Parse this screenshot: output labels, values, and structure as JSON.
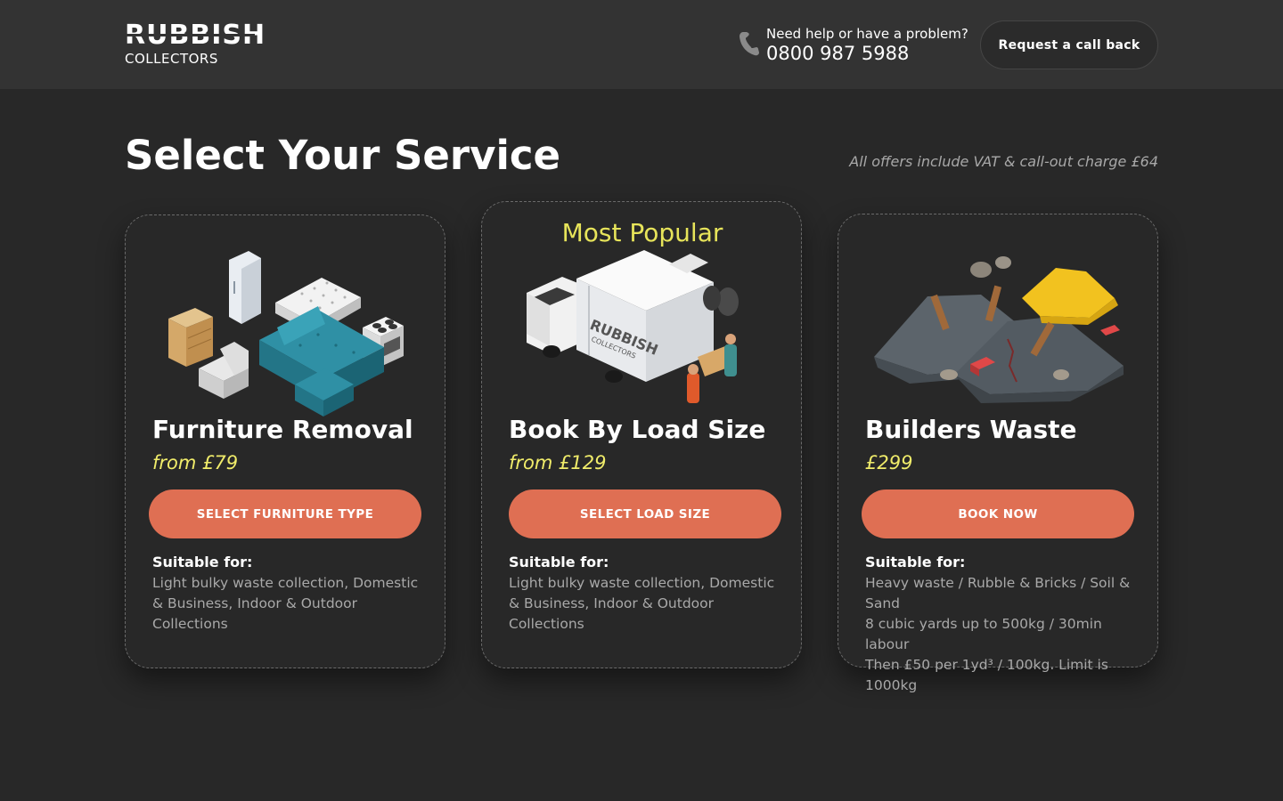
{
  "header": {
    "logo_top": "RUBBISH",
    "logo_bottom": "COLLECTORS",
    "help_text": "Need help or have a problem?",
    "phone_number": "0800 987 5988",
    "callback_label": "Request a call back"
  },
  "main": {
    "title": "Select Your Service",
    "vat_note": "All offers include VAT & call-out charge £64"
  },
  "cards": [
    {
      "title": "Furniture Removal",
      "price": "from £79",
      "button": "SELECT FURNITURE TYPE",
      "suitable_label": "Suitable for:",
      "suitable_text": "Light bulky waste collection, Domestic & Business, Indoor & Outdoor Collections"
    },
    {
      "badge": "Most Popular",
      "title": "Book By Load Size",
      "price": "from £129",
      "button": "SELECT LOAD SIZE",
      "suitable_label": "Suitable for:",
      "suitable_text": "Light bulky waste collection, Domestic & Business, Indoor & Outdoor Collections",
      "van_logo_top": "RUBBISH",
      "van_logo_bottom": "COLLECTORS"
    },
    {
      "title": "Builders Waste",
      "price": "£299",
      "button": "BOOK NOW",
      "suitable_label": "Suitable for:",
      "suitable_lines": [
        "Heavy waste / Rubble & Bricks / Soil & Sand",
        "8 cubic yards up to 500kg / 30min labour",
        "Then £50 per 1yd³ / 100kg. Limit is 1000kg"
      ]
    }
  ],
  "colors": {
    "background": "#282828",
    "header": "#333333",
    "accent_button": "#df6f53",
    "price": "#f0ec6a",
    "badge": "#f2ef5d"
  },
  "icons": [
    "phone-icon",
    "furniture-illustration",
    "van-illustration",
    "builders-waste-illustration"
  ]
}
